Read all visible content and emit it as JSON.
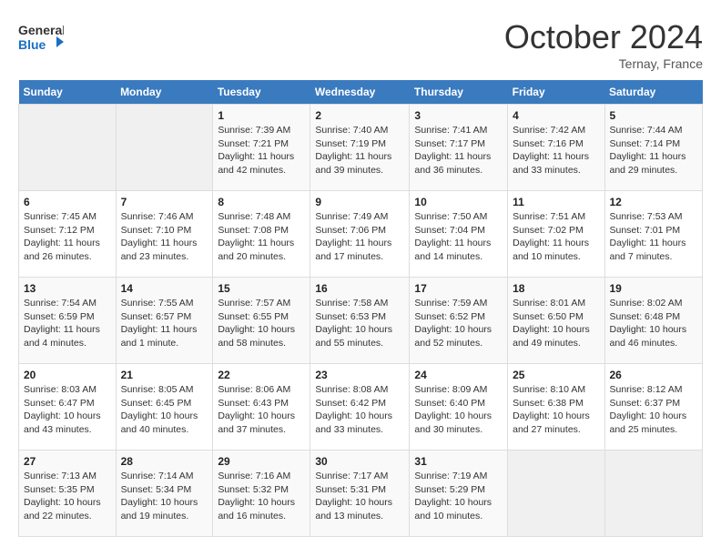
{
  "header": {
    "logo_line1": "General",
    "logo_line2": "Blue",
    "month": "October 2024",
    "location": "Ternay, France"
  },
  "days_of_week": [
    "Sunday",
    "Monday",
    "Tuesday",
    "Wednesday",
    "Thursday",
    "Friday",
    "Saturday"
  ],
  "weeks": [
    [
      {
        "day": "",
        "info": ""
      },
      {
        "day": "",
        "info": ""
      },
      {
        "day": "1",
        "info": "Sunrise: 7:39 AM\nSunset: 7:21 PM\nDaylight: 11 hours and 42 minutes."
      },
      {
        "day": "2",
        "info": "Sunrise: 7:40 AM\nSunset: 7:19 PM\nDaylight: 11 hours and 39 minutes."
      },
      {
        "day": "3",
        "info": "Sunrise: 7:41 AM\nSunset: 7:17 PM\nDaylight: 11 hours and 36 minutes."
      },
      {
        "day": "4",
        "info": "Sunrise: 7:42 AM\nSunset: 7:16 PM\nDaylight: 11 hours and 33 minutes."
      },
      {
        "day": "5",
        "info": "Sunrise: 7:44 AM\nSunset: 7:14 PM\nDaylight: 11 hours and 29 minutes."
      }
    ],
    [
      {
        "day": "6",
        "info": "Sunrise: 7:45 AM\nSunset: 7:12 PM\nDaylight: 11 hours and 26 minutes."
      },
      {
        "day": "7",
        "info": "Sunrise: 7:46 AM\nSunset: 7:10 PM\nDaylight: 11 hours and 23 minutes."
      },
      {
        "day": "8",
        "info": "Sunrise: 7:48 AM\nSunset: 7:08 PM\nDaylight: 11 hours and 20 minutes."
      },
      {
        "day": "9",
        "info": "Sunrise: 7:49 AM\nSunset: 7:06 PM\nDaylight: 11 hours and 17 minutes."
      },
      {
        "day": "10",
        "info": "Sunrise: 7:50 AM\nSunset: 7:04 PM\nDaylight: 11 hours and 14 minutes."
      },
      {
        "day": "11",
        "info": "Sunrise: 7:51 AM\nSunset: 7:02 PM\nDaylight: 11 hours and 10 minutes."
      },
      {
        "day": "12",
        "info": "Sunrise: 7:53 AM\nSunset: 7:01 PM\nDaylight: 11 hours and 7 minutes."
      }
    ],
    [
      {
        "day": "13",
        "info": "Sunrise: 7:54 AM\nSunset: 6:59 PM\nDaylight: 11 hours and 4 minutes."
      },
      {
        "day": "14",
        "info": "Sunrise: 7:55 AM\nSunset: 6:57 PM\nDaylight: 11 hours and 1 minute."
      },
      {
        "day": "15",
        "info": "Sunrise: 7:57 AM\nSunset: 6:55 PM\nDaylight: 10 hours and 58 minutes."
      },
      {
        "day": "16",
        "info": "Sunrise: 7:58 AM\nSunset: 6:53 PM\nDaylight: 10 hours and 55 minutes."
      },
      {
        "day": "17",
        "info": "Sunrise: 7:59 AM\nSunset: 6:52 PM\nDaylight: 10 hours and 52 minutes."
      },
      {
        "day": "18",
        "info": "Sunrise: 8:01 AM\nSunset: 6:50 PM\nDaylight: 10 hours and 49 minutes."
      },
      {
        "day": "19",
        "info": "Sunrise: 8:02 AM\nSunset: 6:48 PM\nDaylight: 10 hours and 46 minutes."
      }
    ],
    [
      {
        "day": "20",
        "info": "Sunrise: 8:03 AM\nSunset: 6:47 PM\nDaylight: 10 hours and 43 minutes."
      },
      {
        "day": "21",
        "info": "Sunrise: 8:05 AM\nSunset: 6:45 PM\nDaylight: 10 hours and 40 minutes."
      },
      {
        "day": "22",
        "info": "Sunrise: 8:06 AM\nSunset: 6:43 PM\nDaylight: 10 hours and 37 minutes."
      },
      {
        "day": "23",
        "info": "Sunrise: 8:08 AM\nSunset: 6:42 PM\nDaylight: 10 hours and 33 minutes."
      },
      {
        "day": "24",
        "info": "Sunrise: 8:09 AM\nSunset: 6:40 PM\nDaylight: 10 hours and 30 minutes."
      },
      {
        "day": "25",
        "info": "Sunrise: 8:10 AM\nSunset: 6:38 PM\nDaylight: 10 hours and 27 minutes."
      },
      {
        "day": "26",
        "info": "Sunrise: 8:12 AM\nSunset: 6:37 PM\nDaylight: 10 hours and 25 minutes."
      }
    ],
    [
      {
        "day": "27",
        "info": "Sunrise: 7:13 AM\nSunset: 5:35 PM\nDaylight: 10 hours and 22 minutes."
      },
      {
        "day": "28",
        "info": "Sunrise: 7:14 AM\nSunset: 5:34 PM\nDaylight: 10 hours and 19 minutes."
      },
      {
        "day": "29",
        "info": "Sunrise: 7:16 AM\nSunset: 5:32 PM\nDaylight: 10 hours and 16 minutes."
      },
      {
        "day": "30",
        "info": "Sunrise: 7:17 AM\nSunset: 5:31 PM\nDaylight: 10 hours and 13 minutes."
      },
      {
        "day": "31",
        "info": "Sunrise: 7:19 AM\nSunset: 5:29 PM\nDaylight: 10 hours and 10 minutes."
      },
      {
        "day": "",
        "info": ""
      },
      {
        "day": "",
        "info": ""
      }
    ]
  ]
}
